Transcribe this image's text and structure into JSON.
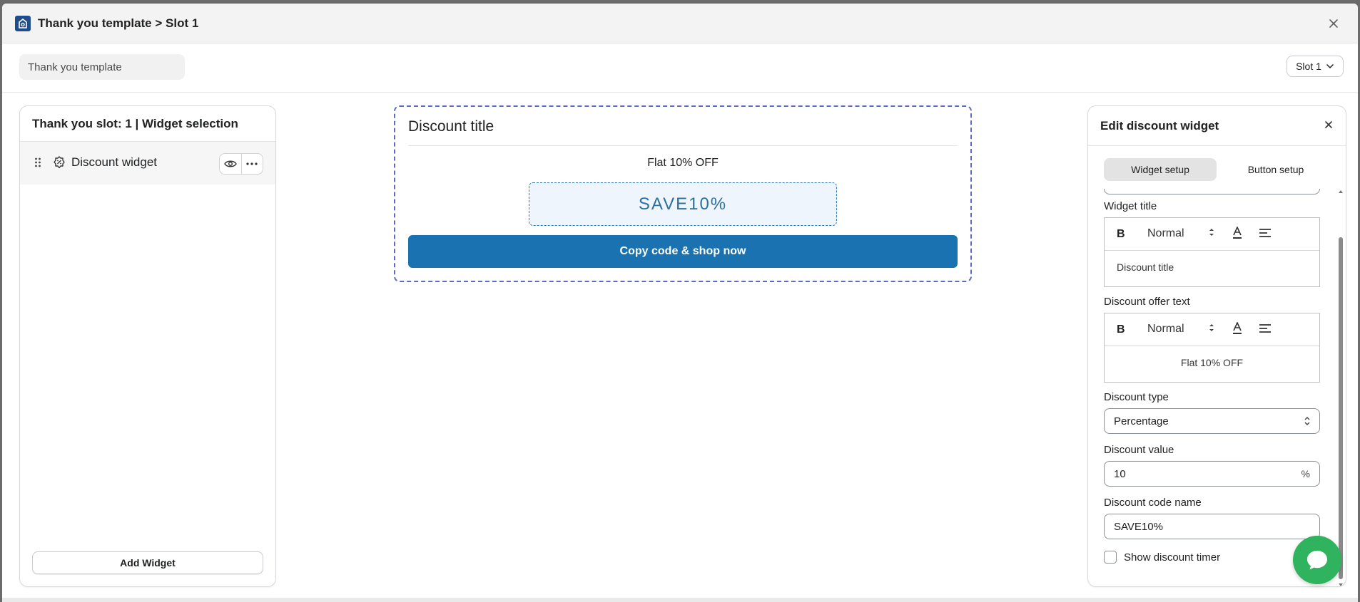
{
  "window": {
    "title": "Thank you template > Slot 1"
  },
  "toolbar": {
    "template_name_value": "Thank you template",
    "slot_label": "Slot 1"
  },
  "left_panel": {
    "header": "Thank you slot: 1 | Widget selection",
    "widgets": [
      {
        "label": "Discount widget"
      }
    ],
    "add_widget_label": "Add Widget"
  },
  "preview": {
    "title": "Discount title",
    "offer_text": "Flat 10% OFF",
    "code": "SAVE10%",
    "cta_label": "Copy code & shop now",
    "colors": {
      "border": "#5c6ac4",
      "button": "#1a73b0",
      "code_bg": "#eef5fc"
    }
  },
  "right_panel": {
    "title": "Edit discount widget",
    "tabs": [
      {
        "label": "Widget setup",
        "active": true
      },
      {
        "label": "Button setup",
        "active": false
      }
    ],
    "widget_title": {
      "label": "Widget title",
      "size": "Normal",
      "bold_glyph": "B",
      "value": "Discount title"
    },
    "offer_text": {
      "label": "Discount offer text",
      "size": "Normal",
      "bold_glyph": "B",
      "value": "Flat 10% OFF"
    },
    "discount_type": {
      "label": "Discount type",
      "value": "Percentage"
    },
    "discount_value": {
      "label": "Discount value",
      "value": "10",
      "suffix": "%"
    },
    "discount_code": {
      "label": "Discount code name",
      "value": "SAVE10%"
    },
    "timer": {
      "label": "Show discount timer",
      "checked": false
    }
  },
  "chat": {
    "icon": "chat-bubble-icon",
    "color": "#2fb35e"
  }
}
